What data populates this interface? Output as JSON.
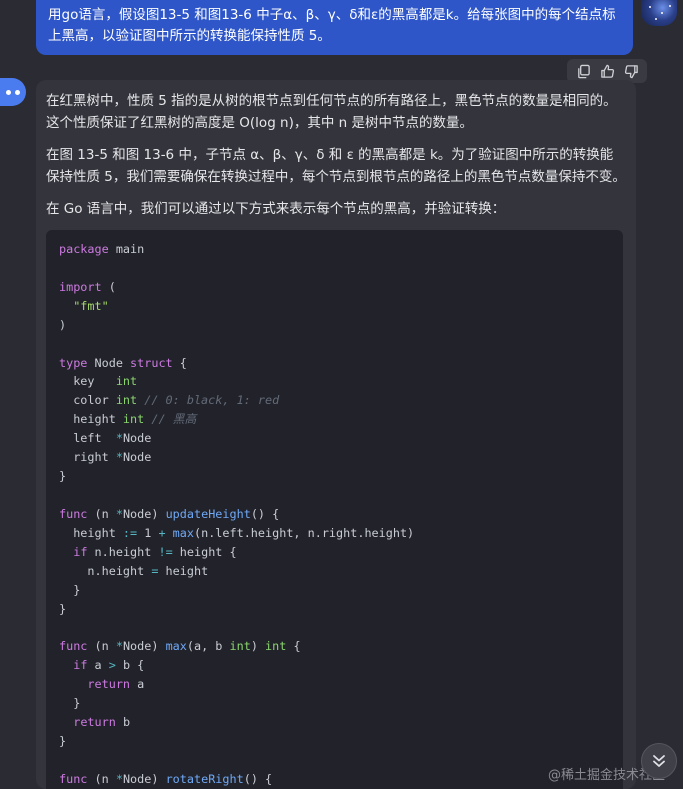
{
  "user_message": {
    "text": "用go语言，假设图13-5 和图13-6 中子α、β、γ、δ和ε的黑高都是k。给每张图中的每个结点标上黑高，以验证图中所示的转换能保持性质 5。"
  },
  "message_actions": [
    {
      "name": "copy-icon"
    },
    {
      "name": "thumbs-up-icon"
    },
    {
      "name": "thumbs-down-icon"
    }
  ],
  "answer": {
    "paragraphs": [
      "在红黑树中，性质 5 指的是从树的根节点到任何节点的所有路径上，黑色节点的数量是相同的。这个性质保证了红黑树的高度是 O(log n)，其中 n 是树中节点的数量。",
      "在图 13-5 和图 13-6 中，子节点 α、β、γ、δ 和 ε 的黑高都是 k。为了验证图中所示的转换能保持性质 5，我们需要确保在转换过程中，每个节点到根节点的路径上的黑色节点数量保持不变。",
      "在 Go 语言中，我们可以通过以下方式来表示每个节点的黑高，并验证转换："
    ],
    "code_lines": [
      [
        {
          "t": "package",
          "c": "kw"
        },
        {
          "t": " main"
        }
      ],
      [],
      [
        {
          "t": "import",
          "c": "kw"
        },
        {
          "t": " ("
        }
      ],
      [
        {
          "t": "  \"fmt\"",
          "c": "str"
        }
      ],
      [
        {
          "t": ")"
        }
      ],
      [],
      [
        {
          "t": "type",
          "c": "kw"
        },
        {
          "t": " Node "
        },
        {
          "t": "struct",
          "c": "kw"
        },
        {
          "t": " {"
        }
      ],
      [
        {
          "t": "  key   "
        },
        {
          "t": "int",
          "c": "ty"
        }
      ],
      [
        {
          "t": "  color "
        },
        {
          "t": "int",
          "c": "ty"
        },
        {
          "t": " // 0: black, 1: red",
          "c": "cm"
        }
      ],
      [
        {
          "t": "  height "
        },
        {
          "t": "int",
          "c": "ty"
        },
        {
          "t": " // 黑高",
          "c": "cm"
        }
      ],
      [
        {
          "t": "  left  "
        },
        {
          "t": "*",
          "c": "op"
        },
        {
          "t": "Node"
        }
      ],
      [
        {
          "t": "  right "
        },
        {
          "t": "*",
          "c": "op"
        },
        {
          "t": "Node"
        }
      ],
      [
        {
          "t": "}"
        }
      ],
      [],
      [
        {
          "t": "func",
          "c": "kw"
        },
        {
          "t": " (n "
        },
        {
          "t": "*",
          "c": "op"
        },
        {
          "t": "Node) "
        },
        {
          "t": "updateHeight",
          "c": "fn"
        },
        {
          "t": "() {"
        }
      ],
      [
        {
          "t": "  height "
        },
        {
          "t": ":=",
          "c": "op"
        },
        {
          "t": " 1 "
        },
        {
          "t": "+",
          "c": "op"
        },
        {
          "t": " "
        },
        {
          "t": "max",
          "c": "fn"
        },
        {
          "t": "(n.left.height, n.right.height)"
        }
      ],
      [
        {
          "t": "  "
        },
        {
          "t": "if",
          "c": "kw"
        },
        {
          "t": " n.height "
        },
        {
          "t": "!=",
          "c": "op"
        },
        {
          "t": " height {"
        }
      ],
      [
        {
          "t": "    n.height "
        },
        {
          "t": "=",
          "c": "op"
        },
        {
          "t": " height"
        }
      ],
      [
        {
          "t": "  }"
        }
      ],
      [
        {
          "t": "}"
        }
      ],
      [],
      [
        {
          "t": "func",
          "c": "kw"
        },
        {
          "t": " (n "
        },
        {
          "t": "*",
          "c": "op"
        },
        {
          "t": "Node) "
        },
        {
          "t": "max",
          "c": "fn"
        },
        {
          "t": "(a, b "
        },
        {
          "t": "int",
          "c": "ty"
        },
        {
          "t": ") "
        },
        {
          "t": "int",
          "c": "ty"
        },
        {
          "t": " {"
        }
      ],
      [
        {
          "t": "  "
        },
        {
          "t": "if",
          "c": "kw"
        },
        {
          "t": " a "
        },
        {
          "t": ">",
          "c": "op"
        },
        {
          "t": " b {"
        }
      ],
      [
        {
          "t": "    "
        },
        {
          "t": "return",
          "c": "kw"
        },
        {
          "t": " a"
        }
      ],
      [
        {
          "t": "  }"
        }
      ],
      [
        {
          "t": "  "
        },
        {
          "t": "return",
          "c": "kw"
        },
        {
          "t": " b"
        }
      ],
      [
        {
          "t": "}"
        }
      ],
      [],
      [
        {
          "t": "func",
          "c": "kw"
        },
        {
          "t": " (n "
        },
        {
          "t": "*",
          "c": "op"
        },
        {
          "t": "Node) "
        },
        {
          "t": "rotateRight",
          "c": "fn"
        },
        {
          "t": "() {"
        }
      ]
    ]
  },
  "watermark": "@稀土掘金技术社区",
  "scroll_down": {
    "icon": "double-chevron-down-icon"
  }
}
